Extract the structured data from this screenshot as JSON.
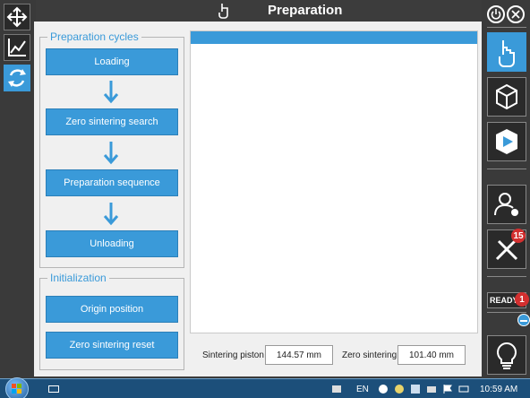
{
  "window": {
    "title": "Preparation"
  },
  "groups": {
    "cycles": {
      "title": "Preparation cycles",
      "buttons": [
        "Loading",
        "Zero sintering search",
        "Preparation sequence",
        "Unloading"
      ]
    },
    "init": {
      "title": "Initialization",
      "buttons": [
        "Origin position",
        "Zero sintering reset"
      ]
    }
  },
  "fields": {
    "sintering_piston": {
      "label": "Sintering piston",
      "value": "144.57 mm"
    },
    "zero_sintering": {
      "label": "Zero sintering",
      "value": "101.40 mm"
    }
  },
  "right_toolbar": {
    "tools_badge": "15",
    "status_label": "READY",
    "status_badge": "1"
  },
  "taskbar": {
    "language": "EN",
    "clock": "10:59 AM"
  },
  "colors": {
    "accent": "#3a9ad9",
    "chrome": "#3a3a3a",
    "panel": "#f0f0f0",
    "badge": "#d32f2f"
  }
}
